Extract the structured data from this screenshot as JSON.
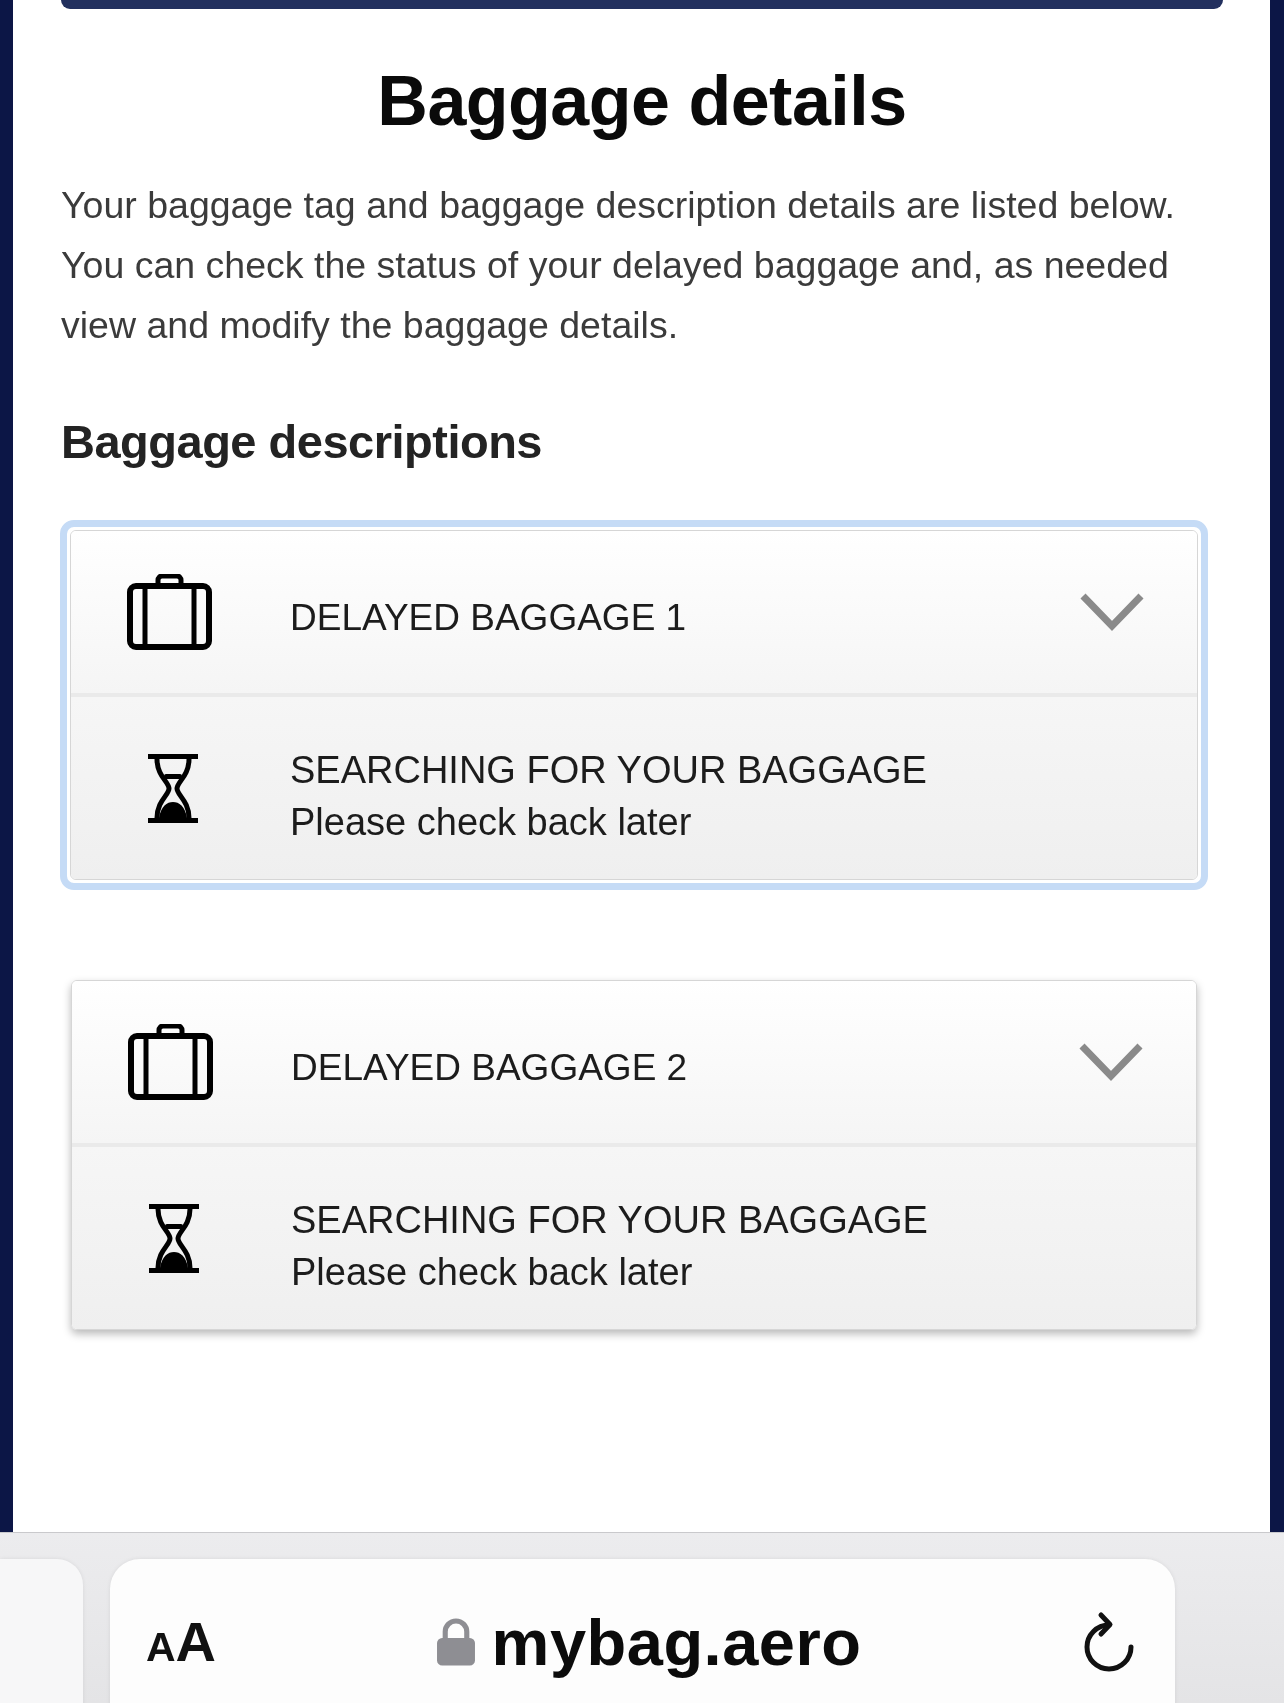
{
  "page": {
    "title": "Baggage details",
    "intro": "Your baggage tag and baggage description details are listed below. You can check the status of your delayed baggage and, as needed view and modify the baggage details.",
    "section_heading": "Baggage descriptions"
  },
  "baggage_items": [
    {
      "title": "DELAYED BAGGAGE 1",
      "focused": true,
      "expanded": false,
      "status": "SEARCHING FOR YOUR BAGGAGE",
      "status_note": "Please check back later"
    },
    {
      "title": "DELAYED BAGGAGE 2",
      "focused": false,
      "expanded": false,
      "status": "SEARCHING FOR YOUR BAGGAGE",
      "status_note": "Please check back later"
    }
  ],
  "browser_bar": {
    "text_size_button": "AA",
    "url": "mybag.aero"
  }
}
